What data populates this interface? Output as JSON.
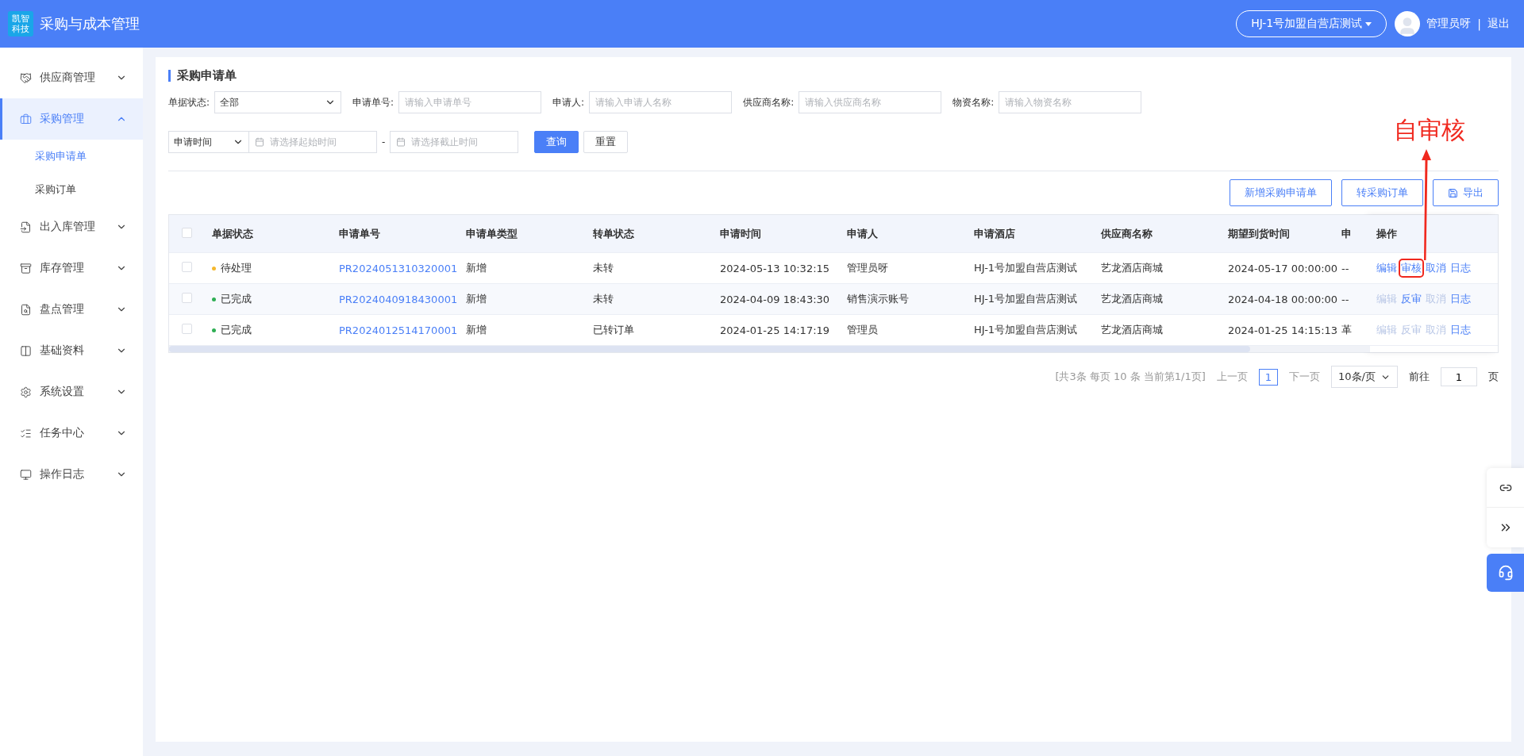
{
  "header": {
    "logo_lines": [
      "凯智",
      "科技"
    ],
    "title": "采购与成本管理",
    "store": "HJ-1号加盟自营店测试",
    "user": "管理员呀",
    "separator": "|",
    "logout": "退出"
  },
  "sidebar": {
    "items": [
      {
        "label": "供应商管理",
        "expanded": false,
        "selected": false
      },
      {
        "label": "采购管理",
        "expanded": true,
        "selected": true,
        "children": [
          {
            "label": "采购申请单",
            "selected": true
          },
          {
            "label": "采购订单",
            "selected": false
          }
        ]
      },
      {
        "label": "出入库管理",
        "expanded": false,
        "selected": false
      },
      {
        "label": "库存管理",
        "expanded": false,
        "selected": false
      },
      {
        "label": "盘点管理",
        "expanded": false,
        "selected": false
      },
      {
        "label": "基础资料",
        "expanded": false,
        "selected": false
      },
      {
        "label": "系统设置",
        "expanded": false,
        "selected": false
      },
      {
        "label": "任务中心",
        "expanded": false,
        "selected": false
      },
      {
        "label": "操作日志",
        "expanded": false,
        "selected": false
      }
    ]
  },
  "page_title": "采购申请单",
  "filters": [
    {
      "kind": "select",
      "label": "单据状态:",
      "value": "全部"
    },
    {
      "kind": "input",
      "label": "申请单号:",
      "placeholder": "请输入申请单号"
    },
    {
      "kind": "input",
      "label": "申请人:",
      "placeholder": "请输入申请人名称"
    },
    {
      "kind": "input",
      "label": "供应商名称:",
      "placeholder": "请输入供应商名称"
    },
    {
      "kind": "input",
      "label": "物资名称:",
      "placeholder": "请输入物资名称"
    }
  ],
  "date_filter": {
    "type": "申请时间",
    "start_placeholder": "请选择起始时间",
    "dash": "-",
    "end_placeholder": "请选择截止时间"
  },
  "search_button": "查询",
  "reset_button": "重置",
  "actions": [
    "新增采购申请单",
    "转采购订单",
    "导出"
  ],
  "table": {
    "all_checked": false,
    "columns": [
      "单据状态",
      "申请单号",
      "申请单类型",
      "转单状态",
      "申请时间",
      "申请人",
      "申请酒店",
      "供应商名称",
      "期望到货时间",
      "申"
    ],
    "ops_column": "操作",
    "rows": [
      {
        "checked": false,
        "status": "待处理",
        "color": "#f5b82e",
        "number": "PR2024051310320001",
        "type": "新增",
        "transfer": "未转",
        "time": "2024-05-13 10:32:15",
        "applicant": "管理员呀",
        "hotel": "HJ-1号加盟自营店测试",
        "supplier": "艺龙酒店商城",
        "expected": "2024-05-17 00:00:00",
        "column_10": "--",
        "ops": [
          {
            "label": "编辑",
            "disabled": false,
            "boxed": false
          },
          {
            "label": "审核",
            "disabled": false,
            "boxed": true
          },
          {
            "label": "取消",
            "disabled": false,
            "boxed": false
          },
          {
            "label": "日志",
            "disabled": false,
            "boxed": false
          }
        ]
      },
      {
        "checked": false,
        "status": "已完成",
        "color": "#2fae54",
        "number": "PR2024040918430001",
        "type": "新增",
        "transfer": "未转",
        "time": "2024-04-09 18:43:30",
        "applicant": "销售演示账号",
        "hotel": "HJ-1号加盟自营店测试",
        "supplier": "艺龙酒店商城",
        "expected": "2024-04-18 00:00:00",
        "column_10": "--",
        "ops": [
          {
            "label": "编辑",
            "disabled": true,
            "boxed": false
          },
          {
            "label": "反审",
            "disabled": false,
            "boxed": false
          },
          {
            "label": "取消",
            "disabled": true,
            "boxed": false
          },
          {
            "label": "日志",
            "disabled": false,
            "boxed": false
          }
        ]
      },
      {
        "checked": false,
        "status": "已完成",
        "color": "#2fae54",
        "number": "PR2024012514170001",
        "type": "新增",
        "transfer": "已转订单",
        "time": "2024-01-25 14:17:19",
        "applicant": "管理员",
        "hotel": "HJ-1号加盟自营店测试",
        "supplier": "艺龙酒店商城",
        "expected": "2024-01-25 14:15:13",
        "column_10": "革",
        "ops": [
          {
            "label": "编辑",
            "disabled": true,
            "boxed": false
          },
          {
            "label": "反审",
            "disabled": true,
            "boxed": false
          },
          {
            "label": "取消",
            "disabled": true,
            "boxed": false
          },
          {
            "label": "日志",
            "disabled": false,
            "boxed": false
          }
        ]
      }
    ]
  },
  "pagination": {
    "summary": "[共3条 每页 10 条 当前第1/1页]",
    "prev": "上一页",
    "pages": [
      {
        "label": "1",
        "selected": true
      }
    ],
    "next": "下一页",
    "page_size": "10条/页",
    "goto_label": "前往",
    "goto_value": "1",
    "goto_suffix": "页"
  },
  "annotation": {
    "text": "自审核"
  }
}
